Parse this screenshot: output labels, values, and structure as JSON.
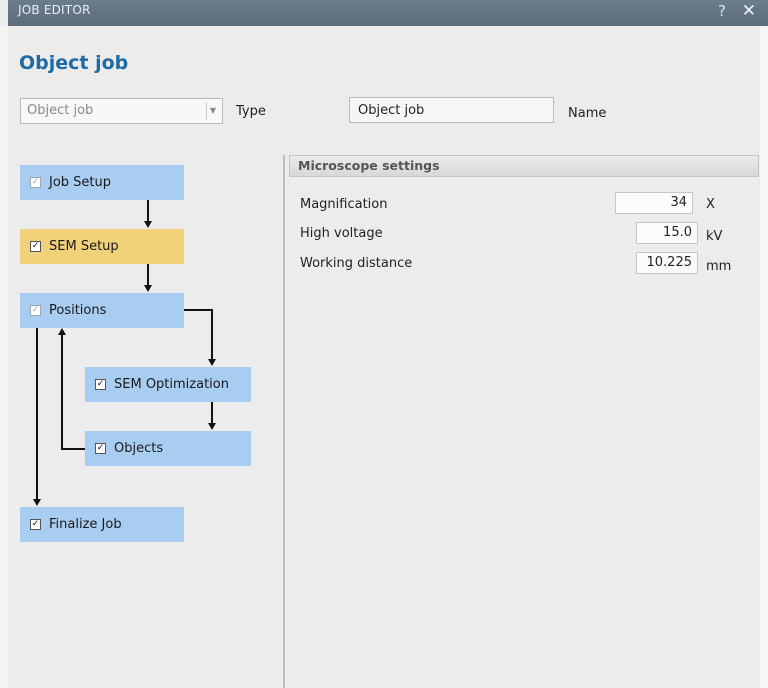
{
  "window": {
    "title": "JOB EDITOR",
    "help_icon": "?",
    "close_icon": "✕"
  },
  "page": {
    "heading": "Object job"
  },
  "job_type": {
    "value": "Object job",
    "label": "Type"
  },
  "job_name": {
    "value": "Object job",
    "label": "Name"
  },
  "workflow": {
    "steps": [
      {
        "label": "Job Setup",
        "checked": true,
        "dimmed": true,
        "active": false
      },
      {
        "label": "SEM Setup",
        "checked": true,
        "dimmed": false,
        "active": true
      },
      {
        "label": "Positions",
        "checked": true,
        "dimmed": true,
        "active": false
      },
      {
        "label": "SEM Optimization",
        "checked": true,
        "dimmed": false,
        "active": false
      },
      {
        "label": "Objects",
        "checked": true,
        "dimmed": false,
        "active": false
      },
      {
        "label": "Finalize Job",
        "checked": true,
        "dimmed": false,
        "active": false
      }
    ]
  },
  "microscope": {
    "title": "Microscope settings",
    "rows": [
      {
        "label": "Magnification",
        "value": "34",
        "unit": "X"
      },
      {
        "label": "High voltage",
        "value": "15.0",
        "unit": "kV"
      },
      {
        "label": "Working distance",
        "value": "10.225",
        "unit": "mm"
      }
    ]
  },
  "colors": {
    "step_blue": "#a9cdf0",
    "step_active": "#f1d17a",
    "heading": "#1d6aa5",
    "titlebar": "#5f6f7d"
  }
}
